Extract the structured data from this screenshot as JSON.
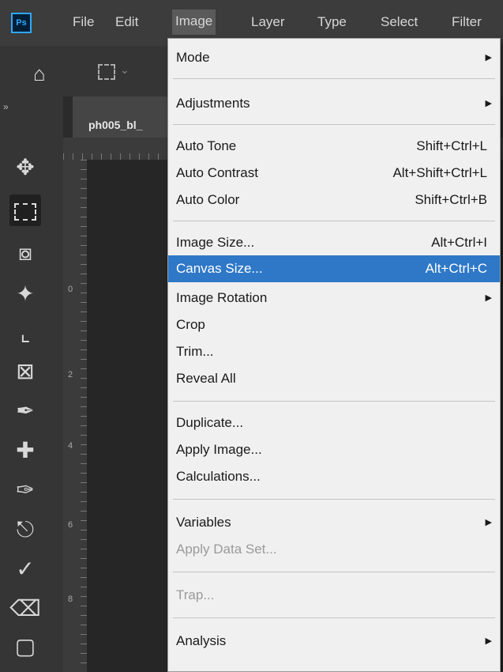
{
  "app": {
    "logo_text": "Ps"
  },
  "menubar": {
    "items": [
      "File",
      "Edit",
      "Image",
      "Layer",
      "Type",
      "Select",
      "Filter"
    ],
    "active": "Image"
  },
  "document": {
    "tab_title": "ph005_bl_"
  },
  "ruler": {
    "labels": [
      "0",
      "2",
      "4",
      "6",
      "8"
    ]
  },
  "image_menu": {
    "items": [
      {
        "label": "Mode",
        "shortcut": "",
        "submenu": true,
        "disabled": false,
        "highlighted": false
      },
      {
        "label": "Adjustments",
        "shortcut": "",
        "submenu": true,
        "disabled": false,
        "highlighted": false
      },
      {
        "label": "Auto Tone",
        "shortcut": "Shift+Ctrl+L",
        "submenu": false,
        "disabled": false,
        "highlighted": false
      },
      {
        "label": "Auto Contrast",
        "shortcut": "Alt+Shift+Ctrl+L",
        "submenu": false,
        "disabled": false,
        "highlighted": false
      },
      {
        "label": "Auto Color",
        "shortcut": "Shift+Ctrl+B",
        "submenu": false,
        "disabled": false,
        "highlighted": false
      },
      {
        "label": "Image Size...",
        "shortcut": "Alt+Ctrl+I",
        "submenu": false,
        "disabled": false,
        "highlighted": false
      },
      {
        "label": "Canvas Size...",
        "shortcut": "Alt+Ctrl+C",
        "submenu": false,
        "disabled": false,
        "highlighted": true
      },
      {
        "label": "Image Rotation",
        "shortcut": "",
        "submenu": true,
        "disabled": false,
        "highlighted": false
      },
      {
        "label": "Crop",
        "shortcut": "",
        "submenu": false,
        "disabled": false,
        "highlighted": false
      },
      {
        "label": "Trim...",
        "shortcut": "",
        "submenu": false,
        "disabled": false,
        "highlighted": false
      },
      {
        "label": "Reveal All",
        "shortcut": "",
        "submenu": false,
        "disabled": false,
        "highlighted": false
      },
      {
        "label": "Duplicate...",
        "shortcut": "",
        "submenu": false,
        "disabled": false,
        "highlighted": false
      },
      {
        "label": "Apply Image...",
        "shortcut": "",
        "submenu": false,
        "disabled": false,
        "highlighted": false
      },
      {
        "label": "Calculations...",
        "shortcut": "",
        "submenu": false,
        "disabled": false,
        "highlighted": false
      },
      {
        "label": "Variables",
        "shortcut": "",
        "submenu": true,
        "disabled": false,
        "highlighted": false
      },
      {
        "label": "Apply Data Set...",
        "shortcut": "",
        "submenu": false,
        "disabled": true,
        "highlighted": false
      },
      {
        "label": "Trap...",
        "shortcut": "",
        "submenu": false,
        "disabled": true,
        "highlighted": false
      },
      {
        "label": "Analysis",
        "shortcut": "",
        "submenu": true,
        "disabled": false,
        "highlighted": false
      }
    ]
  },
  "toolbar": {
    "tools": [
      "move-tool",
      "rectangular-marquee-tool",
      "lasso-tool",
      "magic-wand-tool",
      "crop-tool",
      "frame-tool",
      "eyedropper-tool",
      "healing-brush-tool",
      "brush-tool",
      "clone-stamp-tool",
      "history-brush-tool",
      "eraser-tool",
      "gradient-tool"
    ]
  },
  "colors": {
    "highlight": "#2f78c8",
    "menu_bg": "#f0f0f0",
    "chrome": "#3c3c3c"
  }
}
